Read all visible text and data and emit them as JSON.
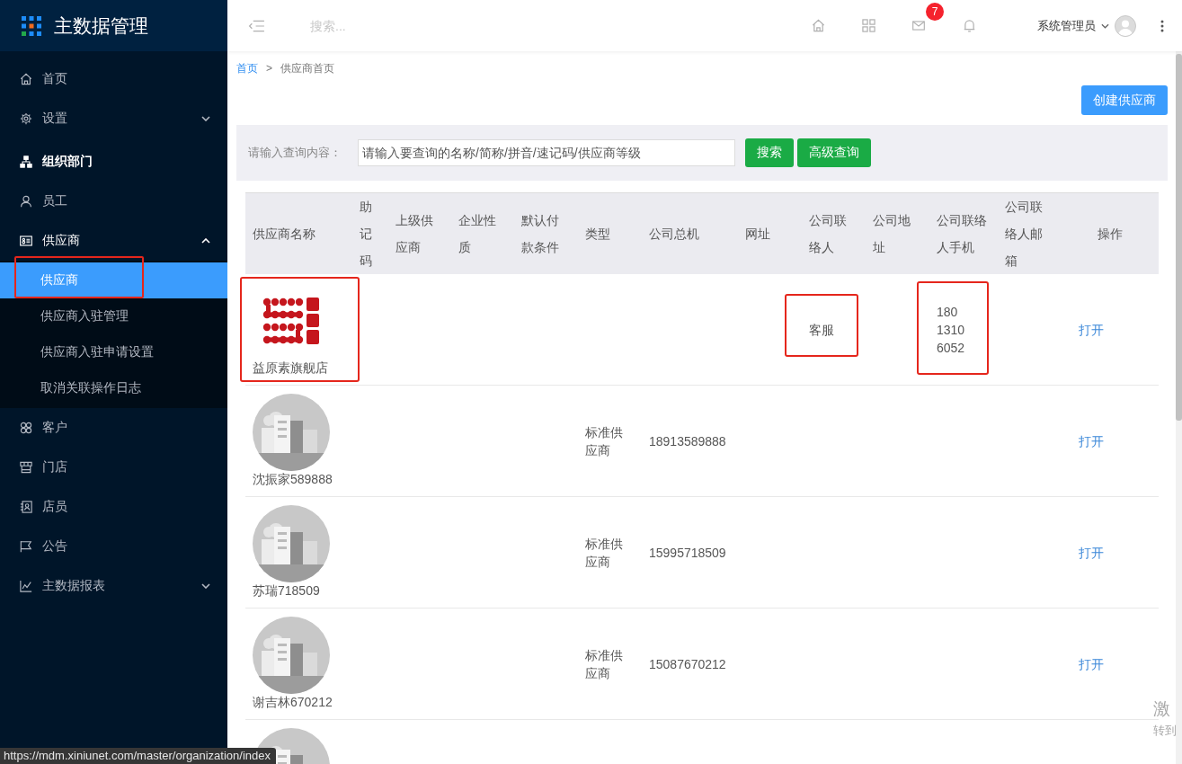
{
  "sidebar": {
    "title": "主数据管理",
    "items": [
      {
        "label": "首页",
        "hovered": false
      },
      {
        "label": "设置",
        "hovered": false,
        "expanded": false
      },
      {
        "label": "组织部门",
        "hovered": true
      },
      {
        "label": "员工",
        "hovered": false
      },
      {
        "label": "供应商",
        "hovered": false,
        "expanded": true,
        "children": [
          {
            "label": "供应商",
            "selected": true,
            "highlighted": true
          },
          {
            "label": "供应商入驻管理",
            "selected": false,
            "highlighted": false
          },
          {
            "label": "供应商入驻申请设置",
            "selected": false,
            "highlighted": false
          },
          {
            "label": "取消关联操作日志",
            "selected": false,
            "highlighted": false
          }
        ]
      },
      {
        "label": "客户",
        "hovered": false
      },
      {
        "label": "门店",
        "hovered": false
      },
      {
        "label": "店员",
        "hovered": false
      },
      {
        "label": "公告",
        "hovered": false
      },
      {
        "label": "主数据报表",
        "hovered": false,
        "expanded": false
      }
    ]
  },
  "topbar": {
    "search": {
      "placeholder": "搜索..."
    },
    "mail_badge": "7",
    "user": "系统管理员"
  },
  "breadcrumb": {
    "items": [
      {
        "label": "首页",
        "kind": "link"
      },
      {
        "label": "供应商首页",
        "kind": "current"
      }
    ],
    "separator": ">"
  },
  "create_button": "创建供应商",
  "query": {
    "label": "请输入查询内容：",
    "placeholder": "请输入要查询的名称/简称/拼音/速记码/供应商等级",
    "buttons": [
      "搜索",
      "高级查询"
    ]
  },
  "table": {
    "columns": [
      "供应商名称",
      "助记码",
      "上级供应商",
      "企业性质",
      "默认付款条件",
      "类型",
      "公司总机",
      "网址",
      "公司联络人",
      "公司地址",
      "公司联络人手机",
      "公司联络人邮箱",
      "操作"
    ],
    "rows": [
      {
        "kind": "logo",
        "name": "益原素旗舰店",
        "contact": "客服",
        "mobile": "180 1310 6052",
        "action": "打开",
        "name_highlighted": true,
        "contact_highlighted": true,
        "mobile_highlighted": true
      },
      {
        "kind": "photo",
        "name": "沈振家589888",
        "type": "标准供应商",
        "phone": "18913589888",
        "action": "打开",
        "name_highlighted": false,
        "contact_highlighted": false,
        "mobile_highlighted": false
      },
      {
        "kind": "photo",
        "name": "苏瑞718509",
        "type": "标准供应商",
        "phone": "15995718509",
        "action": "打开",
        "name_highlighted": false,
        "contact_highlighted": false,
        "mobile_highlighted": false
      },
      {
        "kind": "photo",
        "name": "谢吉林670212",
        "type": "标准供应商",
        "phone": "15087670212",
        "action": "打开",
        "name_highlighted": false,
        "contact_highlighted": false,
        "mobile_highlighted": false
      },
      {
        "kind": "photo"
      }
    ]
  },
  "status_url": "https://mdm.xiniunet.com/master/organization/index",
  "os_notice": {
    "line_1": "激",
    "line_2": "转到"
  }
}
